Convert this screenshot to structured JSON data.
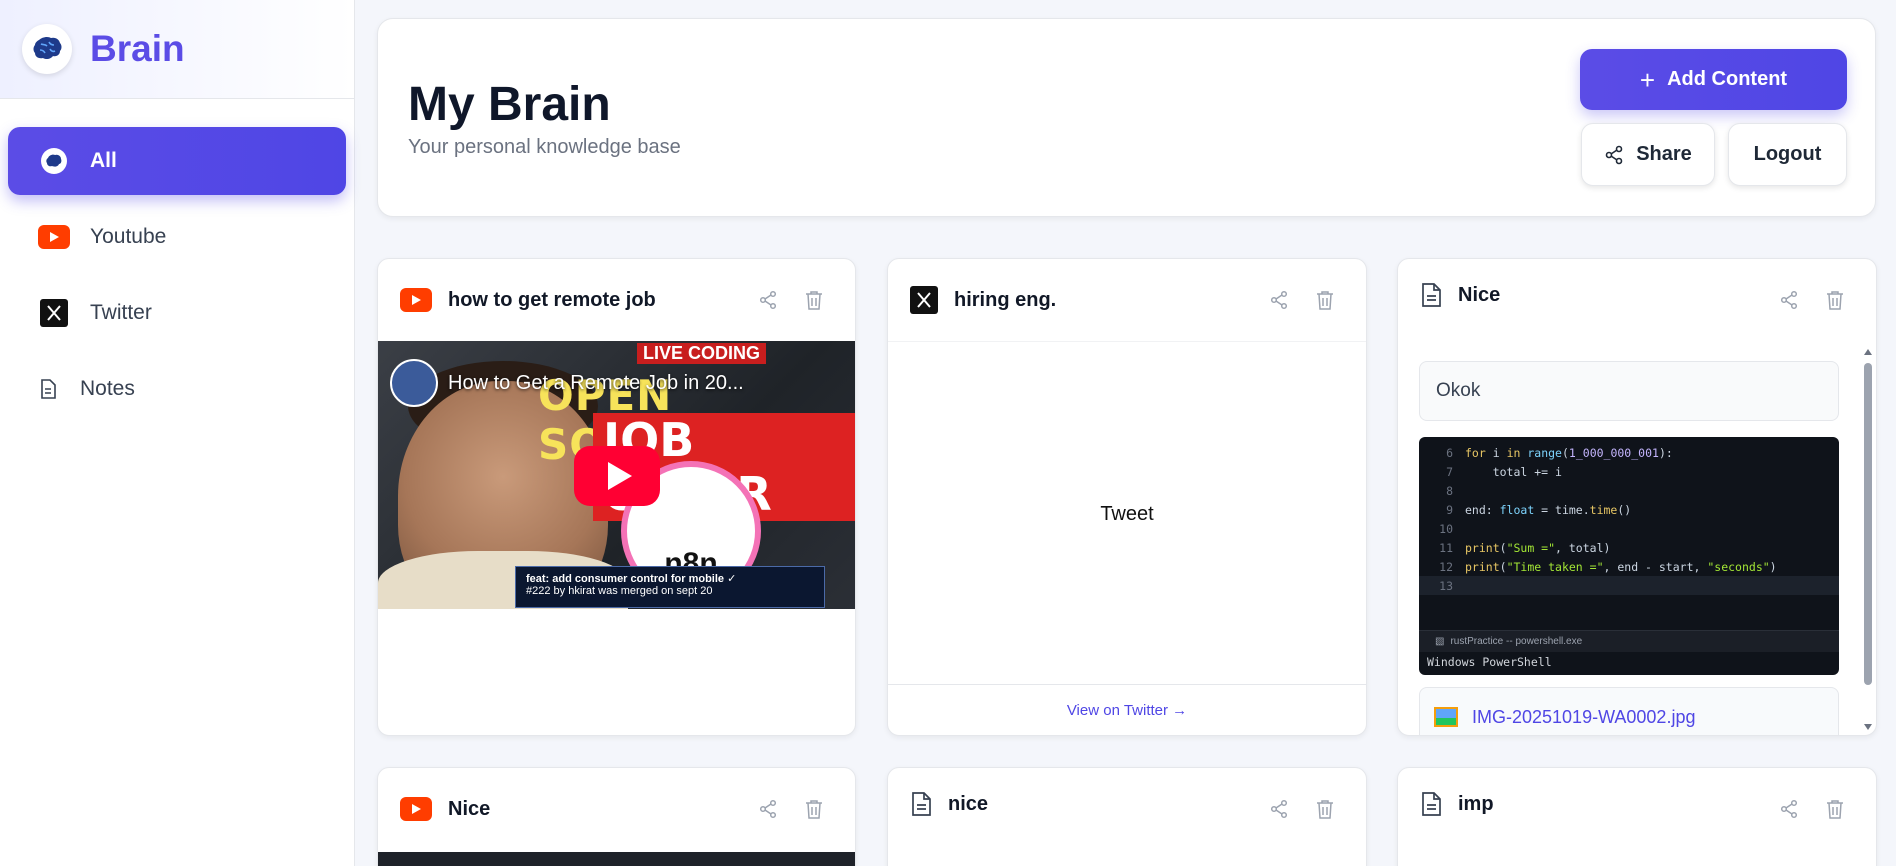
{
  "brand": {
    "name": "Brain",
    "icon": "brain-icon"
  },
  "sidebar": {
    "items": [
      {
        "label": "All",
        "icon": "brain-icon",
        "active": true
      },
      {
        "label": "Youtube",
        "icon": "youtube-icon",
        "active": false
      },
      {
        "label": "Twitter",
        "icon": "x-icon",
        "active": false
      },
      {
        "label": "Notes",
        "icon": "note-icon",
        "active": false
      }
    ]
  },
  "header": {
    "title": "My Brain",
    "subtitle": "Your personal knowledge base",
    "add_label": "Add Content",
    "share_label": "Share",
    "logout_label": "Logout"
  },
  "cards": [
    {
      "type": "youtube",
      "title": "how to get remote job",
      "video_title": "How to Get a Remote Job in 20...",
      "thumb": {
        "live": "LIVE CODING",
        "line1": "OPEN SOURCE TO",
        "line2": "JOB OFFER",
        "logo": "n8n",
        "pr_title": "feat: add consumer control for mobile ✓",
        "pr_sub": "#222 by hkirat was merged on sept 20"
      }
    },
    {
      "type": "twitter",
      "title": "hiring eng.",
      "body": "Tweet",
      "link": "View on Twitter →"
    },
    {
      "type": "note",
      "title": "Nice",
      "text": "Okok",
      "file_name": "IMG-20251019-WA0002.jpg",
      "code": {
        "lines": [
          {
            "n": "6",
            "t": "for i in range(1_000_000_001):"
          },
          {
            "n": "7",
            "t": "    total += i"
          },
          {
            "n": "8",
            "t": ""
          },
          {
            "n": "9",
            "t": "end: float = time.time()"
          },
          {
            "n": "10",
            "t": ""
          },
          {
            "n": "11",
            "t": "print(\"Sum =\", total)"
          },
          {
            "n": "12",
            "t": "print(\"Time taken =\", end - start, \"seconds\")"
          },
          {
            "n": "13",
            "t": ""
          }
        ],
        "terminal_tab": "rustPractice -- powershell.exe",
        "terminal_line": "Windows PowerShell"
      }
    },
    {
      "type": "youtube",
      "title": "Nice"
    },
    {
      "type": "note",
      "title": "nice"
    },
    {
      "type": "note",
      "title": "imp"
    }
  ],
  "colors": {
    "accent": "#4f46e5",
    "youtube": "#ff3d00",
    "twitter": "#111111"
  }
}
